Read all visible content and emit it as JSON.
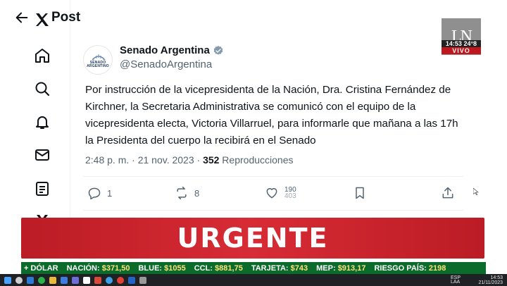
{
  "nav": {
    "items": [
      "x-logo",
      "home",
      "explore",
      "notifications",
      "messages",
      "lists",
      "x-premium"
    ]
  },
  "header": {
    "title": "Post"
  },
  "post": {
    "avatar_text": "SENADO ARGENTINO",
    "author": "Senado Argentina",
    "handle": "@SenadoArgentina",
    "body": "Por instrucción de la vicepresidenta de la Nación, Dra. Cristina Fernández de Kirchner, la Secretaria Administrativa se comunicó con el equipo de la vicepresidenta electa, Victoria Villarruel, para informarle que mañana a las 17h la Presidenta del cuerpo la recibirá en el Senado",
    "timestamp": "2:48 p. m. · 21 nov. 2023 · ",
    "views_count": "352",
    "views_label": " Reproducciones",
    "replies": "1",
    "reposts": "8",
    "likes_top": "190",
    "likes_bottom": "403"
  },
  "channel": {
    "logo": "LN",
    "time": "14:53  24°8",
    "live": "VIVO"
  },
  "banner": {
    "text": "URGENTE"
  },
  "ticker": [
    {
      "label": "+ DÓLAR",
      "value": ""
    },
    {
      "label": "NACIÓN: ",
      "value": "$371,50"
    },
    {
      "label": "BLUE: ",
      "value": "$1055"
    },
    {
      "label": "CCL: ",
      "value": "$881,75"
    },
    {
      "label": "TARJETA: ",
      "value": "$743"
    },
    {
      "label": "MEP: ",
      "value": "$913,17"
    },
    {
      "label": "RIESGO PAÍS: ",
      "value": "2198"
    }
  ],
  "taskbar": {
    "lang_top": "ESP",
    "lang_bottom": "LAA",
    "clock": "14:53",
    "date": "21/11/2023"
  },
  "colors": {
    "banner": "#d5202a",
    "ticker": "#0b6b2a",
    "verified": "#1d9bf0"
  }
}
